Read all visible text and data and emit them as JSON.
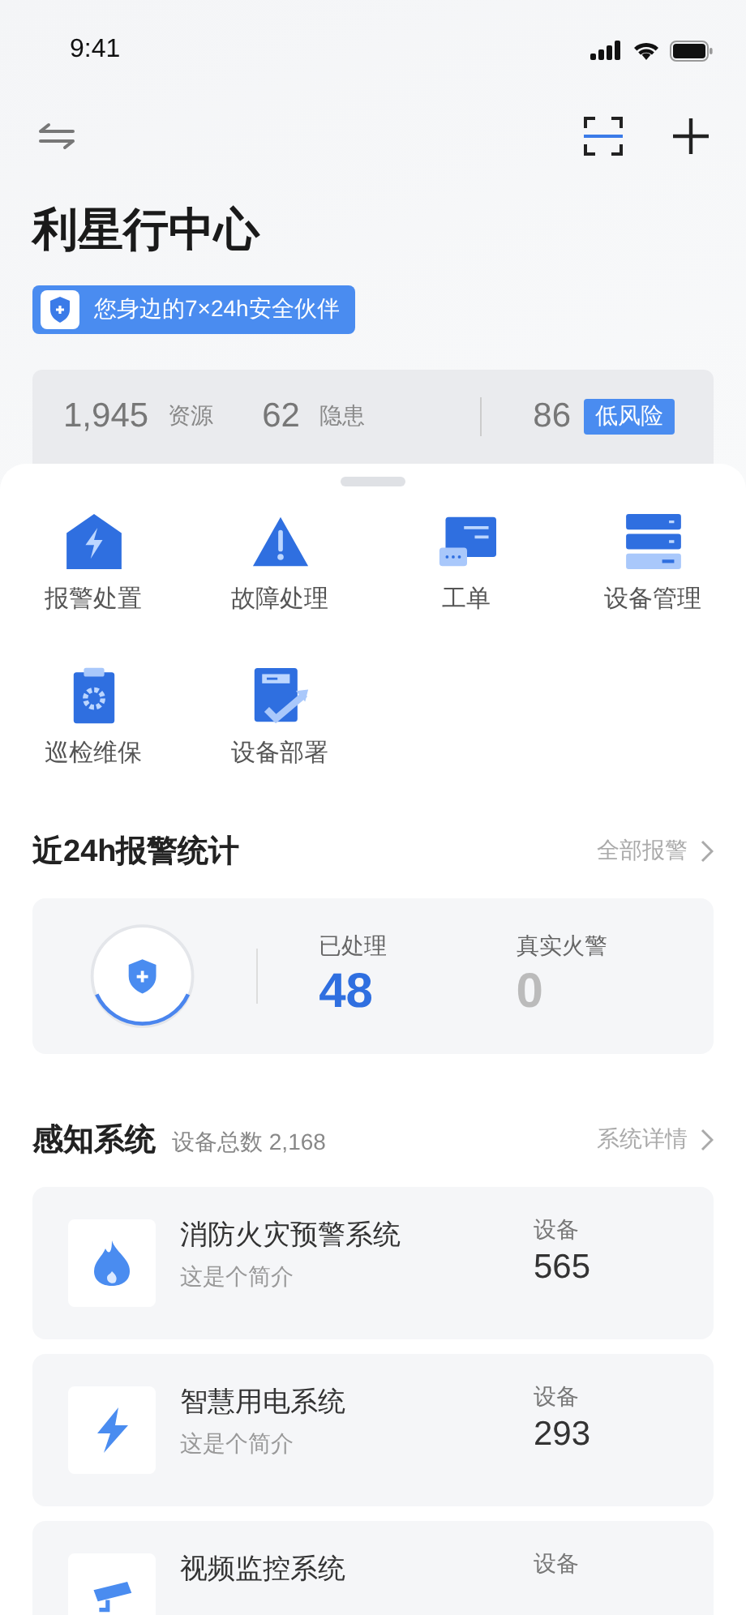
{
  "status_bar": {
    "time": "9:41"
  },
  "header": {
    "title": "利星行中心",
    "slogan": "您身边的7×24h安全伙伴"
  },
  "summary": {
    "resources": "1,945",
    "resources_label": "资源",
    "hazards": "62",
    "hazards_label": "隐患",
    "score": "86",
    "risk": "低风险"
  },
  "shortcuts": [
    {
      "label": "报警处置"
    },
    {
      "label": "故障处理"
    },
    {
      "label": "工单"
    },
    {
      "label": "设备管理"
    },
    {
      "label": "巡检维保"
    },
    {
      "label": "设备部署"
    }
  ],
  "alarm_stats": {
    "title": "近24h报警统计",
    "link": "全部报警",
    "handled_label": "已处理",
    "handled": "48",
    "real_label": "真实火警",
    "real": "0"
  },
  "systems": {
    "title": "感知系统",
    "total": "设备总数 2,168",
    "link": "系统详情",
    "items": [
      {
        "name": "消防火灾预警系统",
        "desc": "这是个简介",
        "count_label": "设备",
        "count": "565"
      },
      {
        "name": "智慧用电系统",
        "desc": "这是个简介",
        "count_label": "设备",
        "count": "293"
      },
      {
        "name": "视频监控系统",
        "count_label": "设备"
      }
    ]
  }
}
